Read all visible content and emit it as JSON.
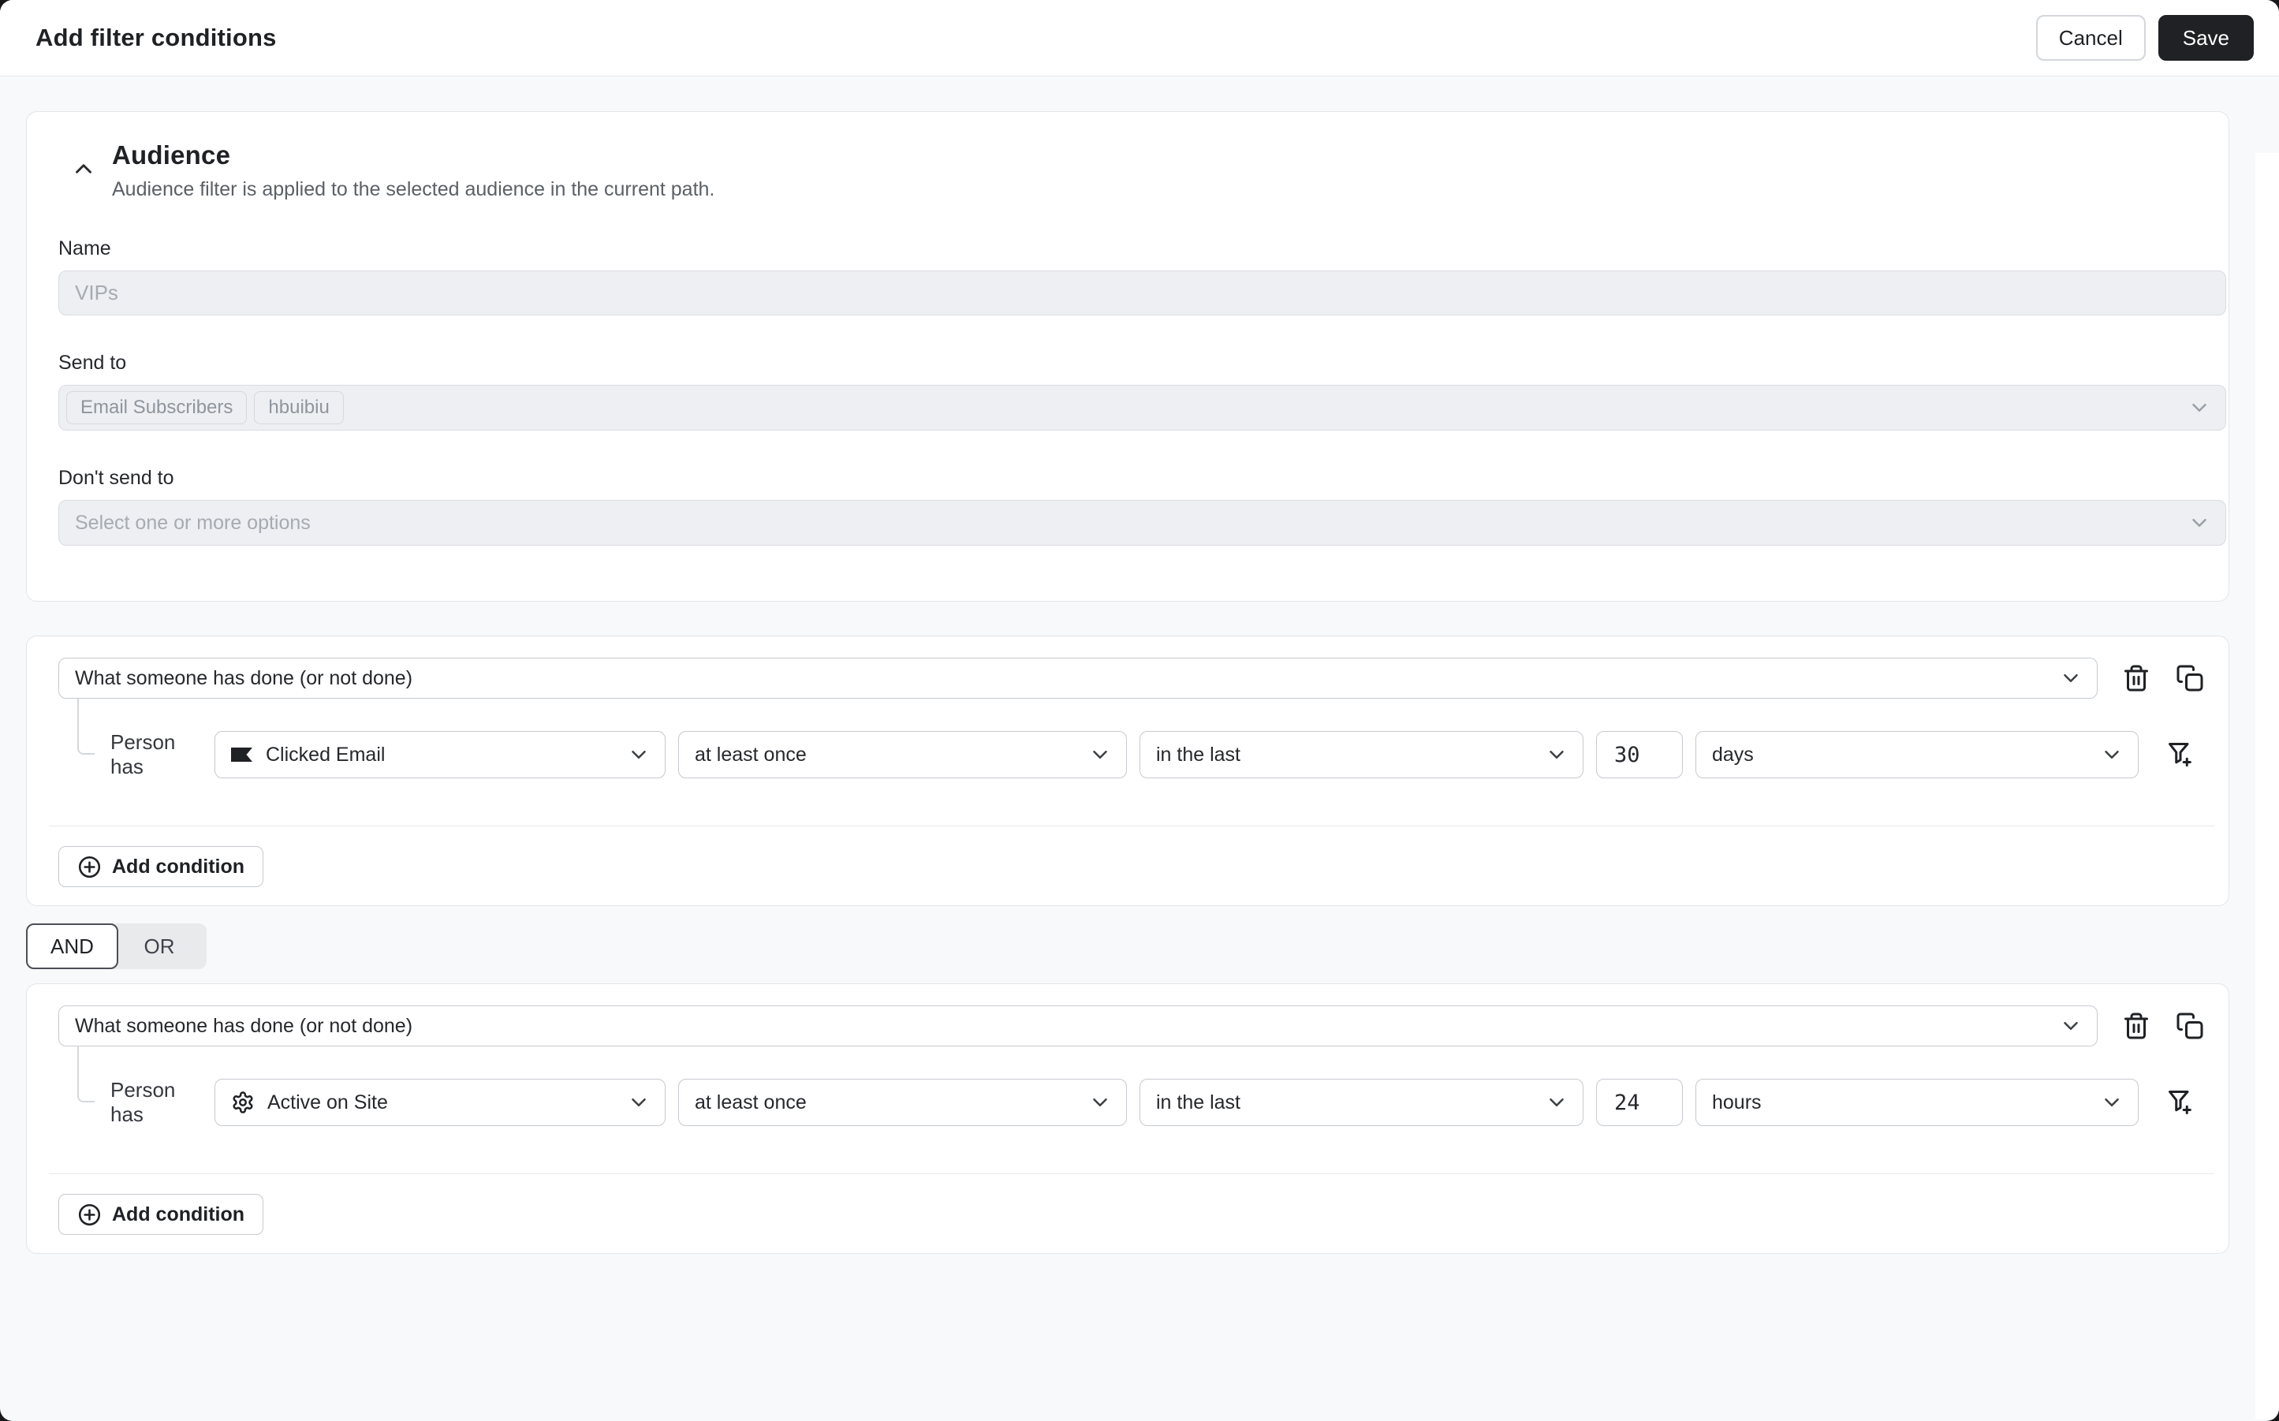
{
  "header": {
    "title": "Add filter conditions",
    "cancel_label": "Cancel",
    "save_label": "Save"
  },
  "audience": {
    "title": "Audience",
    "subtitle": "Audience filter is applied to the selected audience in the current path.",
    "name_label": "Name",
    "name_placeholder": "VIPs",
    "send_to_label": "Send to",
    "send_to_chips": [
      "Email Subscribers",
      "hbuibiu"
    ],
    "dont_send_to_label": "Don't send to",
    "dont_send_to_placeholder": "Select one or more options"
  },
  "operator_toggle": {
    "and_label": "AND",
    "or_label": "OR",
    "selected": "AND"
  },
  "conditions": [
    {
      "type": "What someone has done (or not done)",
      "prefix": "Person has",
      "metric": "Clicked Email",
      "metric_icon": "flag-icon",
      "frequency": "at least once",
      "timeframe": "in the last",
      "value": "30",
      "unit": "days",
      "add_condition_label": "Add condition"
    },
    {
      "type": "What someone has done (or not done)",
      "prefix": "Person has",
      "metric": "Active on Site",
      "metric_icon": "gear-icon",
      "frequency": "at least once",
      "timeframe": "in the last",
      "value": "24",
      "unit": "hours",
      "add_condition_label": "Add condition"
    }
  ],
  "icons": {
    "collapse": "chevron-up",
    "select_caret": "chevron-down",
    "delete": "trash",
    "duplicate": "copy",
    "add": "circle-plus",
    "time_filter": "funnel-plus"
  },
  "colors": {
    "backdrop": "#17171a",
    "page_bg": "#f8f9fb",
    "card_bg": "#ffffff",
    "card_border": "#e3e5e8",
    "input_bg": "#edeff2",
    "input_border": "#d9dce0",
    "select_border": "#c6cacf",
    "save_button_bg": "#1f2125",
    "placeholder_text": "#a6abb2",
    "muted_text": "#5b6066"
  }
}
